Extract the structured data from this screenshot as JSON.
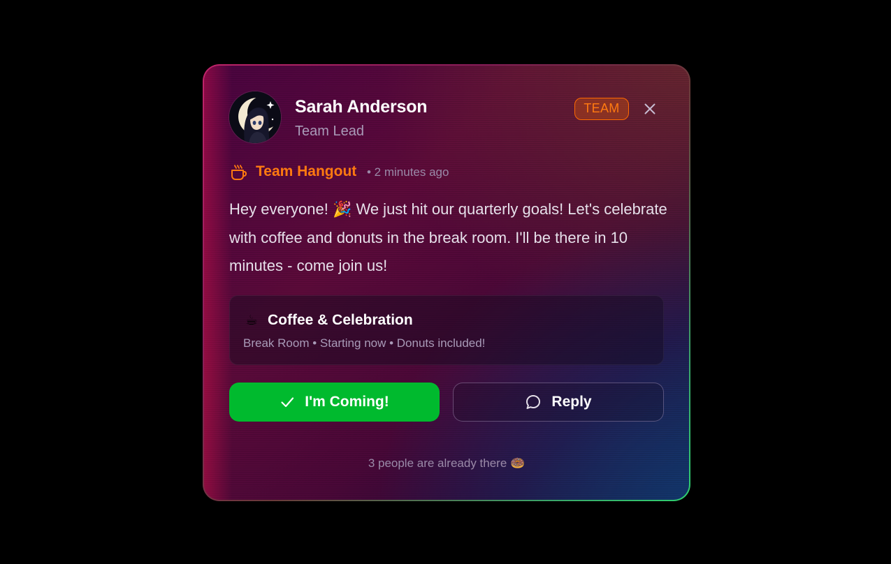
{
  "sender": {
    "name": "Sarah Anderson",
    "role": "Team Lead",
    "avatar_icon": "anime-avatar-icon"
  },
  "badge": {
    "label": "TEAM",
    "color": "#ff6a00"
  },
  "channel": {
    "name": "Team Hangout",
    "time": "• 2 minutes ago",
    "icon": "coffee-cup-icon"
  },
  "message": {
    "text": "Hey everyone! 🎉 We just hit our quarterly goals! Let's celebrate with coffee and donuts in the break room. I'll be there in 10 minutes - come join us!"
  },
  "event": {
    "icon": "☕",
    "title": "Coffee & Celebration",
    "details": "Break Room • Starting now • Donuts included!"
  },
  "actions": {
    "coming_label": "I'm Coming!",
    "reply_label": "Reply",
    "accent_color": "#00ba2e"
  },
  "footer": {
    "note": "3 people are already there 🍩"
  }
}
